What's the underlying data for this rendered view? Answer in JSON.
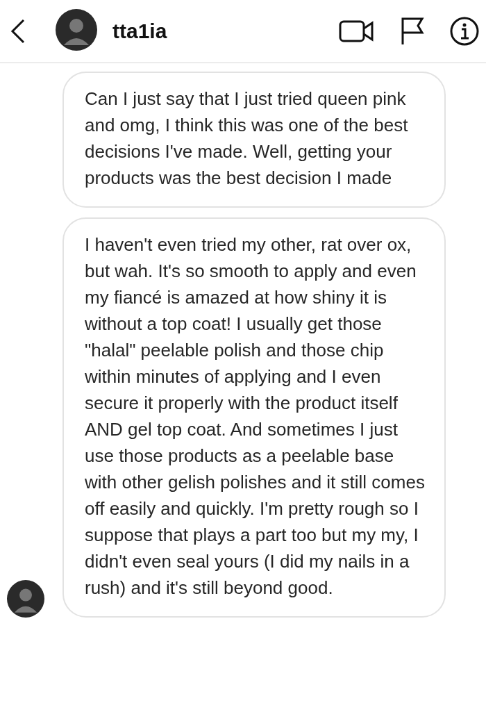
{
  "header": {
    "username": "tta1ia"
  },
  "messages": [
    {
      "text": "Can I just say that I just tried queen pink and omg, I think this was one of the best decisions I've made. Well, getting your products was the best decision I made",
      "show_avatar": false
    },
    {
      "text": "I haven't even tried my other, rat over ox, but wah. It's so smooth to apply and even my fiancé is amazed at how shiny it is without a top coat! I usually get those \"halal\" peelable polish and those chip within minutes of applying and I even secure it properly with the product itself AND gel top coat. And sometimes I just use those products as a peelable base with other gelish polishes and it still comes off easily and quickly. I'm pretty rough so I suppose that plays a part too but my my, I didn't even seal yours (I did my nails in a rush) and it's still beyond good.",
      "show_avatar": true
    }
  ]
}
